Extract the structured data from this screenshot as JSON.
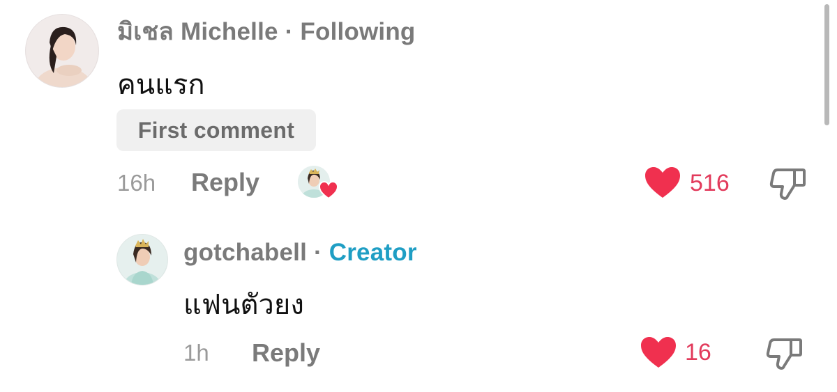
{
  "comments": [
    {
      "username": "มิเชล Michelle",
      "separator": "·",
      "status": "Following",
      "text": "คนแรก",
      "translation_label": "First comment",
      "time": "16h",
      "reply_label": "Reply",
      "likes": "516",
      "liked_by_creator": true
    },
    {
      "username": "gotchabell",
      "separator": "·",
      "status": "Creator",
      "text": "แฟนตัวยง",
      "time": "1h",
      "reply_label": "Reply",
      "likes": "16"
    }
  ],
  "colors": {
    "heart": "#f0304f",
    "like_count": "#e23a5b",
    "creator_label": "#1f9ec4",
    "meta_text": "#7a7a7a"
  },
  "icons": {
    "like": "heart-icon",
    "dislike": "thumbs-down-icon",
    "creator_like": "creator-avatar-heart-badge"
  }
}
